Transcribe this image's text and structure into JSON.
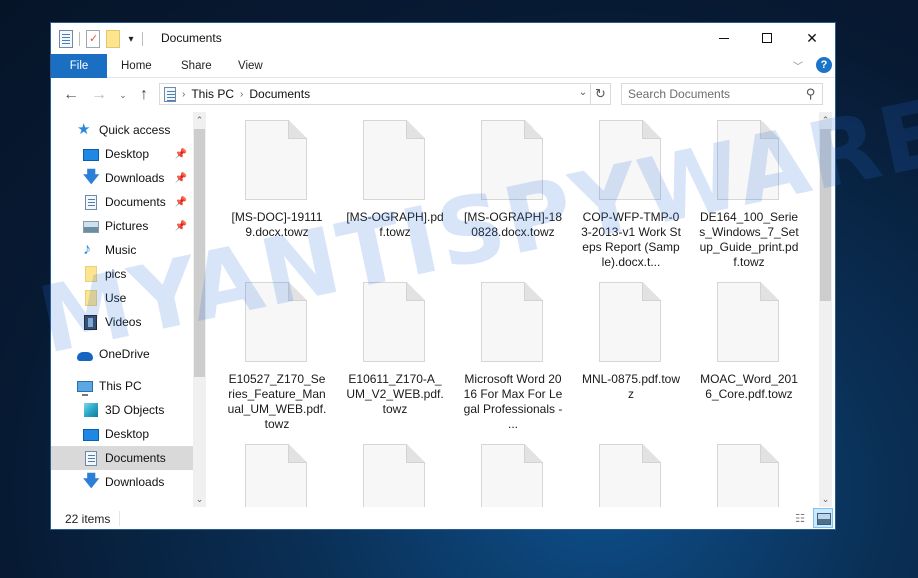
{
  "window": {
    "title": "Documents",
    "controls": {
      "minimize": "minimize",
      "maximize": "maximize",
      "close": "close"
    }
  },
  "quick_access_toolbar": {
    "icons": [
      "properties-icon",
      "new-folder-icon",
      "customize-dropdown-icon"
    ]
  },
  "ribbon": {
    "tabs": [
      {
        "label": "File",
        "active": true
      },
      {
        "label": "Home"
      },
      {
        "label": "Share"
      },
      {
        "label": "View"
      }
    ],
    "accent_color": "#1a6fc2"
  },
  "address": {
    "breadcrumbs": [
      "This PC",
      "Documents"
    ],
    "search_placeholder": "Search Documents"
  },
  "sidebar": {
    "items": [
      {
        "label": "Quick access",
        "icon": "star-icon",
        "level": 0
      },
      {
        "label": "Desktop",
        "icon": "desktop-icon",
        "level": 1,
        "pinned": true
      },
      {
        "label": "Downloads",
        "icon": "download-icon",
        "level": 1,
        "pinned": true
      },
      {
        "label": "Documents",
        "icon": "documents-icon",
        "level": 1,
        "pinned": true
      },
      {
        "label": "Pictures",
        "icon": "pictures-icon",
        "level": 1,
        "pinned": true
      },
      {
        "label": "Music",
        "icon": "music-icon",
        "level": 1
      },
      {
        "label": "pics",
        "icon": "folder-icon",
        "level": 1
      },
      {
        "label": "Use",
        "icon": "folder-icon",
        "level": 1
      },
      {
        "label": "Videos",
        "icon": "videos-icon",
        "level": 1
      },
      {
        "label": "OneDrive",
        "icon": "onedrive-icon",
        "level": 0
      },
      {
        "label": "This PC",
        "icon": "this-pc-icon",
        "level": 0
      },
      {
        "label": "3D Objects",
        "icon": "3d-objects-icon",
        "level": 1
      },
      {
        "label": "Desktop",
        "icon": "desktop-icon",
        "level": 1
      },
      {
        "label": "Documents",
        "icon": "documents-icon",
        "level": 1,
        "selected": true
      },
      {
        "label": "Downloads",
        "icon": "download-icon",
        "level": 1
      }
    ]
  },
  "files": [
    {
      "name": "[MS-DOC]-191119.docx.towz"
    },
    {
      "name": "[MS-OGRAPH].pdf.towz"
    },
    {
      "name": "[MS-OGRAPH]-180828.docx.towz"
    },
    {
      "name": "COP-WFP-TMP-03-2013-v1 Work Steps Report (Sample).docx.t..."
    },
    {
      "name": "DE164_100_Series_Windows_7_Setup_Guide_print.pdf.towz"
    },
    {
      "name": "E10527_Z170_Series_Feature_Manual_UM_WEB.pdf.towz"
    },
    {
      "name": "E10611_Z170-A_UM_V2_WEB.pdf.towz"
    },
    {
      "name": "Microsoft Word 2016 For Max For Legal Professionals - ..."
    },
    {
      "name": "MNL-0875.pdf.towz"
    },
    {
      "name": "MOAC_Word_2016_Core.pdf.towz"
    },
    {
      "name": ""
    },
    {
      "name": ""
    },
    {
      "name": ""
    },
    {
      "name": ""
    },
    {
      "name": ""
    }
  ],
  "status": {
    "item_count": "22 items"
  },
  "watermark": "MYANTISPYWARE.COM"
}
